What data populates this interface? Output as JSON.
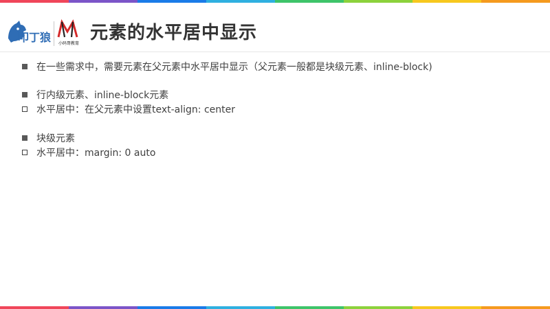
{
  "slide": {
    "title": "元素的水平居中显示",
    "stripe_colors": [
      "#f0465a",
      "#7b55c8",
      "#1a7be8",
      "#2fb0e0",
      "#3ec46a",
      "#8cd23c",
      "#f7c81e",
      "#f59a1e",
      "#f0465a"
    ]
  },
  "logos": {
    "brand1": {
      "text": "叩丁狼",
      "color": "#2f6db5",
      "icon": "wolf-head-logo"
    },
    "brand2": {
      "text": "小码哥教育",
      "color": "#d42a2a",
      "icon": "m-letter-logo"
    }
  },
  "content": {
    "lines": [
      {
        "bullet": "filled",
        "text": "在一些需求中，需要元素在父元素中水平居中显示（父元素一般都是块级元素、inline-block)"
      },
      {
        "bullet": "filled",
        "text": "行内级元素、inline-block元素"
      },
      {
        "bullet": "hollow",
        "text": "水平居中：在父元素中设置text-align: center"
      },
      {
        "bullet": "filled",
        "text": "块级元素"
      },
      {
        "bullet": "hollow",
        "text": "水平居中：margin: 0 auto"
      }
    ]
  }
}
